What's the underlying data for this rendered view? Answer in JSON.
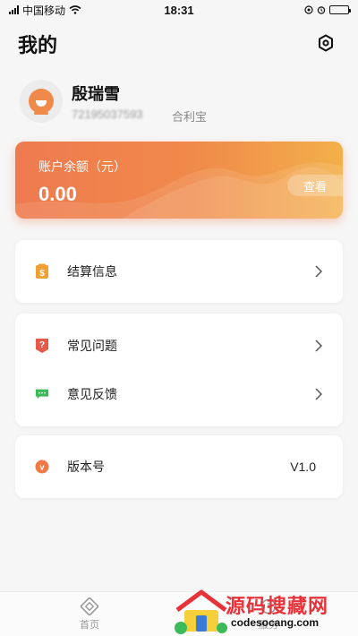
{
  "status_bar": {
    "carrier": "中国移动",
    "time": "18:31"
  },
  "header": {
    "title": "我的",
    "settings_icon": "hexagon-settings-icon"
  },
  "profile": {
    "name": "殷瑞雪",
    "phone": "72195037593",
    "org": "合利宝",
    "avatar_color": "#f08a4b"
  },
  "balance": {
    "label": "账户余额（元）",
    "value": "0.00",
    "view_label": "查看",
    "gradient": [
      "#ef7a4f",
      "#f3b04a"
    ]
  },
  "menu_groups": [
    [
      {
        "label": "结算信息",
        "icon": "settlement-icon",
        "icon_color": "#f0a033"
      }
    ],
    [
      {
        "label": "常见问题",
        "icon": "faq-icon",
        "icon_color": "#e55a4a"
      },
      {
        "label": "意见反馈",
        "icon": "feedback-icon",
        "icon_color": "#3cba5a"
      }
    ],
    [
      {
        "label": "版本号",
        "icon": "version-icon",
        "icon_color": "#f07a45",
        "value": "V1.0"
      }
    ]
  ],
  "tabbar": {
    "tabs": [
      {
        "label": "首页",
        "icon": "home-icon"
      },
      {
        "label": "服务",
        "icon": "service-icon"
      }
    ]
  },
  "watermark": {
    "title": "源码搜藏网",
    "url": "codesocang.com"
  }
}
